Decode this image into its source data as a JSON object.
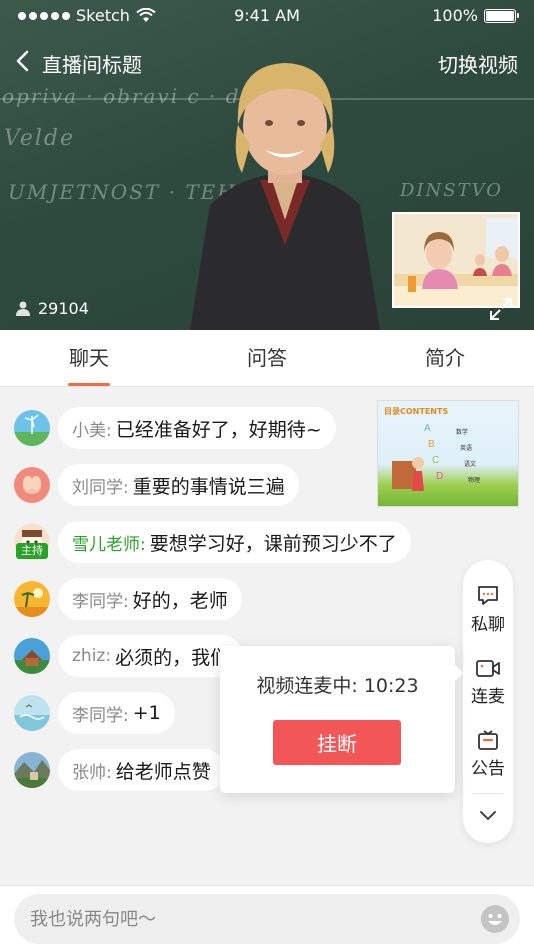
{
  "status_bar": {
    "carrier": "Sketch",
    "time": "9:41 AM",
    "battery": "100%"
  },
  "navbar": {
    "title": "直播间标题",
    "switch_label": "切换视频"
  },
  "video": {
    "viewers": "29104"
  },
  "tabs": [
    {
      "label": "聊天",
      "active": true
    },
    {
      "label": "问答",
      "active": false
    },
    {
      "label": "简介",
      "active": false
    }
  ],
  "messages": [
    {
      "name": "小美:",
      "text": "已经准备好了，好期待~"
    },
    {
      "name": "刘同学:",
      "text": "重要的事情说三遍"
    },
    {
      "name": "雪儿老师:",
      "text": "要想学习好，课前预习少不了",
      "badge": "主持"
    },
    {
      "name": "李同学:",
      "text": "好的，老师"
    },
    {
      "name": "zhiz:",
      "text": "必须的，我们"
    },
    {
      "name": "李同学:",
      "text": "+1"
    },
    {
      "name": "张帅:",
      "text": "给老师点赞"
    }
  ],
  "slide_thumb": {
    "title": "目录CONTENTS",
    "items": [
      "数学",
      "英语",
      "语文",
      "物理"
    ]
  },
  "sidebar": {
    "items": [
      {
        "label": "私聊",
        "icon": "chat-bubble-icon"
      },
      {
        "label": "连麦",
        "icon": "video-camera-icon"
      },
      {
        "label": "公告",
        "icon": "bulletin-icon"
      }
    ],
    "more_icon": "chevron-down-icon"
  },
  "popup": {
    "text": "视频连麦中: 10:23",
    "hangup_label": "挂断"
  },
  "input": {
    "placeholder": "我也说两句吧～",
    "value": ""
  },
  "colors": {
    "accent": "#f06b3d",
    "hangup": "#f35656",
    "host": "#2aa22a"
  }
}
